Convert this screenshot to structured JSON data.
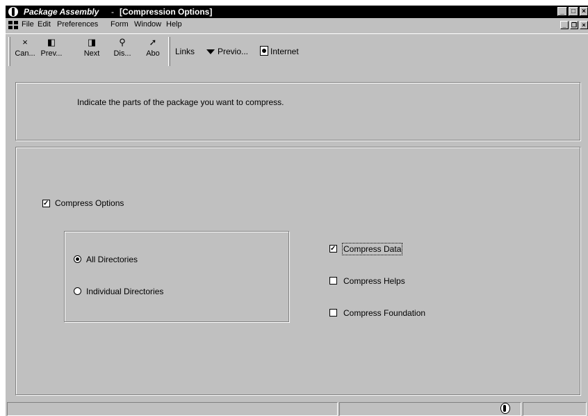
{
  "window": {
    "app_title": "Package Assembly",
    "separator": "-",
    "form_title": "[Compression Options]",
    "controls": {
      "minimize": "_",
      "maximize": "□",
      "close": "×"
    }
  },
  "menu": {
    "items": [
      "File",
      "Edit",
      "Preferences",
      "Form",
      "Window",
      "Help"
    ],
    "mdi_controls": {
      "minimize": "_",
      "restore": "❐",
      "close": "×"
    }
  },
  "toolbar": {
    "buttons": [
      {
        "label": "Can...",
        "icon": "close-icon"
      },
      {
        "label": "Prev...",
        "icon": "previous-icon"
      },
      {
        "label": "Next",
        "icon": "next-icon"
      },
      {
        "label": "Dis...",
        "icon": "display-icon"
      },
      {
        "label": "Abo",
        "icon": "about-icon"
      }
    ],
    "links_label": "Links",
    "previous_label": "Previo...",
    "internet_label": "Internet"
  },
  "header": {
    "instruction": "Indicate the parts of the package you want to compress."
  },
  "options": {
    "compress_options": {
      "label": "Compress Options",
      "checked": true
    },
    "directories": [
      {
        "label": "All Directories",
        "selected": true
      },
      {
        "label": "Individual Directories",
        "selected": false
      }
    ],
    "compress": [
      {
        "label": "Compress Data",
        "checked": true
      },
      {
        "label": "Compress Helps",
        "checked": false
      },
      {
        "label": "Compress Foundation",
        "checked": false
      }
    ]
  },
  "colors": {
    "title_bg": "#000000",
    "face": "#c0c0c0",
    "shadow": "#808080"
  }
}
